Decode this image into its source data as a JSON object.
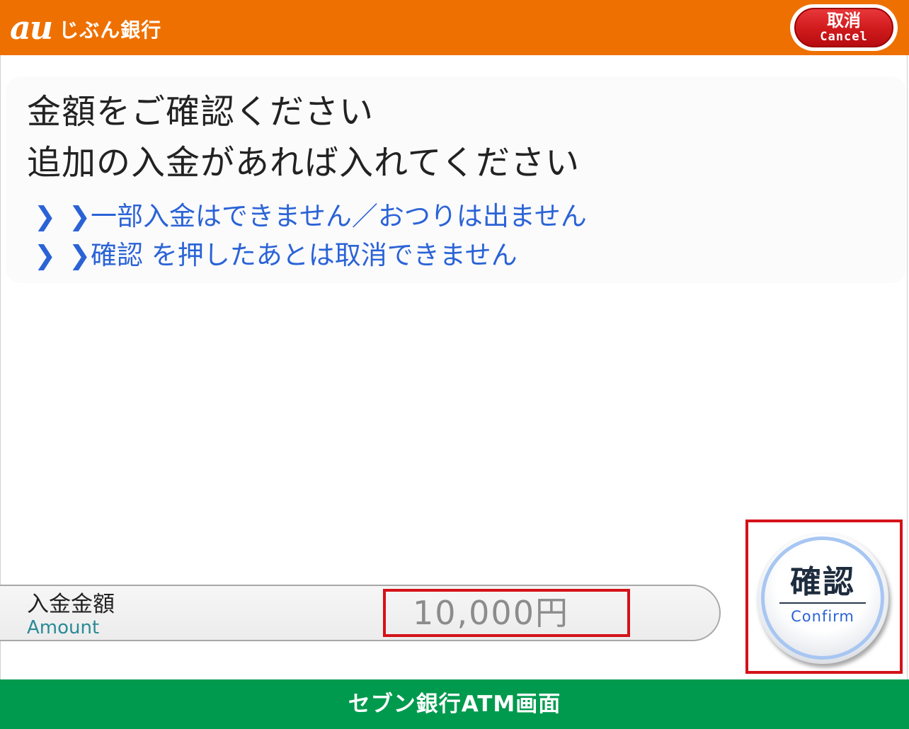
{
  "header": {
    "logo_mark": "au",
    "logo_name": "じぶん銀行",
    "cancel_label_jp": "取消",
    "cancel_label_en": "Cancel",
    "background_color": "#ee7000"
  },
  "message": {
    "title_line_1": "金額をご確認ください",
    "title_line_2": "追加の入金があれば入れてください",
    "notes": [
      "一部入金はできません／おつりは出ません",
      "確認 を押したあとは取消できません"
    ],
    "chevron": "❯",
    "note_color": "#2b63d6"
  },
  "amount": {
    "label_jp": "入金金額",
    "label_en": "Amount",
    "value": "10,000円"
  },
  "confirm": {
    "label_jp": "確認",
    "label_en": "Confirm"
  },
  "footer": {
    "caption": "セブン銀行ATM画面",
    "background_color": "#009a4e"
  },
  "highlight_color": "#d41218"
}
